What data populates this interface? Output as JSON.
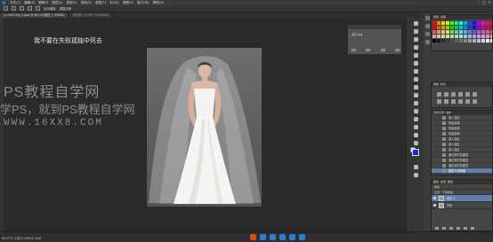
{
  "menubar": {
    "logo": "Ps",
    "items": [
      "文件(F)",
      "编辑(E)",
      "图像(I)",
      "图层(L)",
      "类型(Y)",
      "选择(S)",
      "滤镜(T)",
      "3D(D)",
      "视图(V)",
      "窗口(W)",
      "帮助(H)"
    ],
    "window_controls": [
      "–",
      "□",
      "×"
    ]
  },
  "options": {
    "items": [
      "自动增强",
      "调整边缘"
    ]
  },
  "tabs": [
    {
      "label": "u=1621002_1.psd @ 66.7%(图层 1, RGB/8)"
    },
    {
      "label": "未标题-1 @ 66.7%(RGB/8)"
    }
  ],
  "canvas": {
    "caption": "我不要在失败孤独中死去",
    "watermark_1": "PS教程自学网",
    "watermark_2": "学PS，就到PS教程自学网",
    "watermark_3": "WWW.16XX8.COM"
  },
  "float_panel": {
    "label": "源点 ▪ ▪"
  },
  "status": {
    "text": "66.67%   文档:2.26M/8.34M"
  },
  "taskbar": {
    "icons": [
      "logo-icon",
      "chat-icon",
      "mic-icon",
      "keyboard-icon",
      "shirt-icon",
      "grid-icon"
    ]
  },
  "panels": {
    "swatches_tabs": [
      "颜色",
      "色板"
    ],
    "adjust_tabs": [
      "调整",
      "样式"
    ],
    "history_tabs": [
      "历史记录",
      "动作"
    ],
    "history_items": [
      "载入选区",
      "快速选择",
      "快速选择",
      "快速选择",
      "载入选区",
      "载入选区",
      "载入选区",
      "通过拷贝的图层",
      "通过拷贝的图层",
      "通过拷贝的图层",
      "图层不透明度"
    ],
    "layers_tabs": [
      "图层",
      "通道",
      "路径"
    ],
    "layers_controls": [
      "类型",
      "正常",
      "不透明度:"
    ],
    "layers": [
      {
        "name": "图层 1",
        "active": true
      },
      {
        "name": "背景",
        "active": false
      }
    ]
  },
  "colors": {
    "foreground": "#1a2fd6",
    "background": "#ffffff",
    "selection": "#5f7fa8"
  }
}
